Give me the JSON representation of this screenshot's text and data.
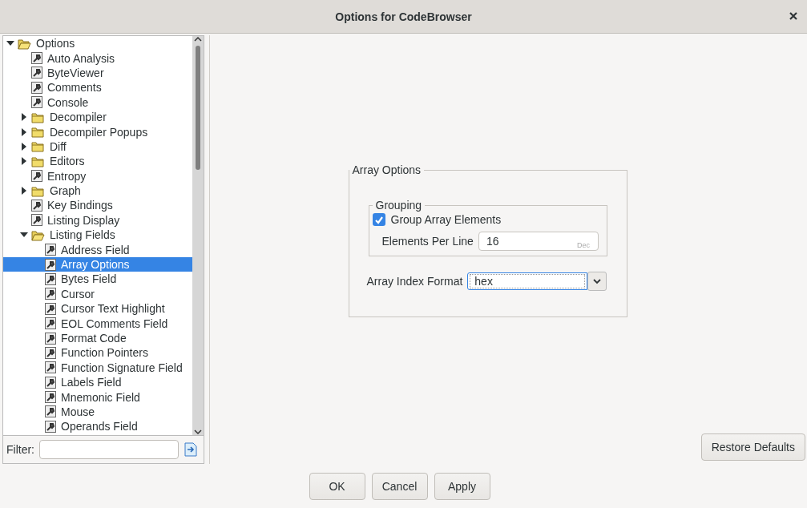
{
  "window": {
    "title": "Options for CodeBrowser"
  },
  "tree": [
    {
      "label": "Options",
      "kind": "folder",
      "expanded": true,
      "selected": false,
      "children": [
        {
          "label": "Auto Analysis",
          "kind": "leaf",
          "selected": false
        },
        {
          "label": "ByteViewer",
          "kind": "leaf",
          "selected": false
        },
        {
          "label": "Comments",
          "kind": "leaf",
          "selected": false
        },
        {
          "label": "Console",
          "kind": "leaf",
          "selected": false
        },
        {
          "label": "Decompiler",
          "kind": "folder",
          "expanded": false,
          "selected": false
        },
        {
          "label": "Decompiler Popups",
          "kind": "folder",
          "expanded": false,
          "selected": false
        },
        {
          "label": "Diff",
          "kind": "folder",
          "expanded": false,
          "selected": false
        },
        {
          "label": "Editors",
          "kind": "folder",
          "expanded": false,
          "selected": false
        },
        {
          "label": "Entropy",
          "kind": "leaf",
          "selected": false
        },
        {
          "label": "Graph",
          "kind": "folder",
          "expanded": false,
          "selected": false
        },
        {
          "label": "Key Bindings",
          "kind": "leaf",
          "selected": false
        },
        {
          "label": "Listing Display",
          "kind": "leaf",
          "selected": false
        },
        {
          "label": "Listing Fields",
          "kind": "folder",
          "expanded": true,
          "selected": false,
          "children": [
            {
              "label": "Address Field",
              "kind": "leaf",
              "selected": false
            },
            {
              "label": "Array Options",
              "kind": "leaf",
              "selected": true
            },
            {
              "label": "Bytes Field",
              "kind": "leaf",
              "selected": false
            },
            {
              "label": "Cursor",
              "kind": "leaf",
              "selected": false
            },
            {
              "label": "Cursor Text Highlight",
              "kind": "leaf",
              "selected": false
            },
            {
              "label": "EOL Comments Field",
              "kind": "leaf",
              "selected": false
            },
            {
              "label": "Format Code",
              "kind": "leaf",
              "selected": false
            },
            {
              "label": "Function Pointers",
              "kind": "leaf",
              "selected": false
            },
            {
              "label": "Function Signature Field",
              "kind": "leaf",
              "selected": false
            },
            {
              "label": "Labels Field",
              "kind": "leaf",
              "selected": false
            },
            {
              "label": "Mnemonic Field",
              "kind": "leaf",
              "selected": false
            },
            {
              "label": "Mouse",
              "kind": "leaf",
              "selected": false
            },
            {
              "label": "Operands Field",
              "kind": "leaf",
              "selected": false
            }
          ]
        }
      ]
    }
  ],
  "filter": {
    "label": "Filter:"
  },
  "panel": {
    "title": "Array Options",
    "grouping": {
      "title": "Grouping",
      "checkbox": {
        "label": "Group Array Elements",
        "checked": true
      },
      "elements_per_line": {
        "label": "Elements Per Line",
        "value": "16",
        "suffix": "Dec"
      }
    },
    "index_format": {
      "label": "Array Index Format",
      "value": "hex"
    }
  },
  "restore_button": "Restore Defaults",
  "buttons": [
    "OK",
    "Cancel",
    "Apply"
  ]
}
